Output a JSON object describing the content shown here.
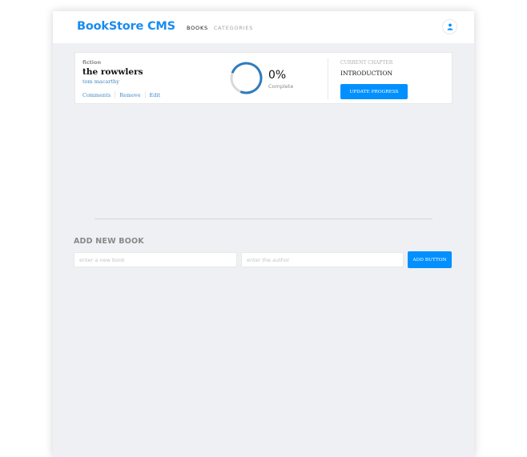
{
  "header": {
    "logo": "BookStore CMS",
    "nav": [
      "BOOKS",
      "CATEGORIES"
    ],
    "user_icon": "user-icon"
  },
  "books": [
    {
      "genre": "fiction",
      "title": "the rowwlers",
      "author": "tom macarthy",
      "actions": [
        "Comments",
        "Remove",
        "Edit"
      ],
      "progress_percent": 0,
      "progress_text": "0%",
      "progress_label": "Complete",
      "chapter_label": "CURRENT CHAPTER",
      "chapter_name": "INTRODUCTION",
      "update_button": "UPDATE PROGRESS"
    }
  ],
  "add_form": {
    "title": "ADD NEW BOOK",
    "title_placeholder": "enter a new book",
    "author_placeholder": "enter the author",
    "submit": "ADD BUTTON"
  },
  "colors": {
    "accent": "#0290ff",
    "logo": "#1a8cf0",
    "ring": "#307bbe",
    "background": "#eef0f3"
  }
}
